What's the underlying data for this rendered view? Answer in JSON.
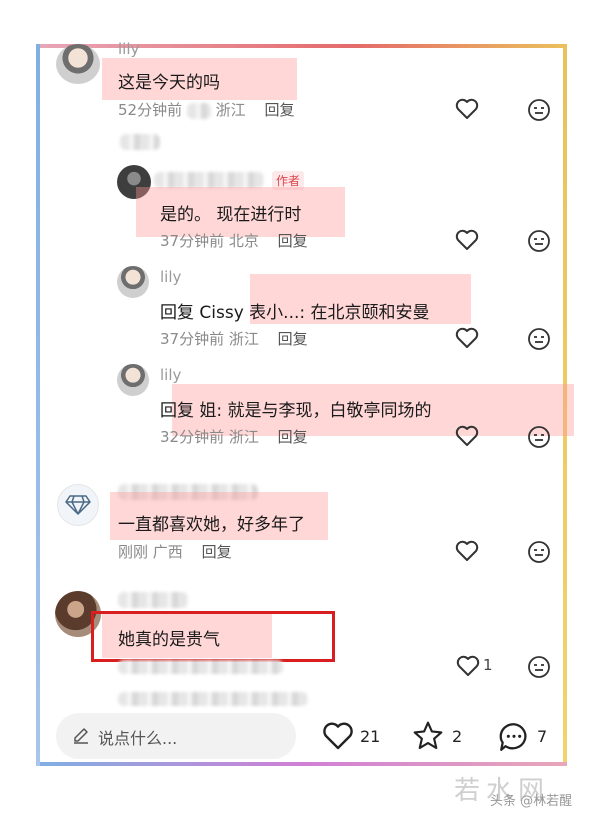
{
  "comments": [
    {
      "name": "lily",
      "text": "这是今天的吗",
      "time": "52分钟前",
      "location": "浙江",
      "reply": "回复"
    },
    {
      "author_tag": "作者",
      "text": "是的。 现在进行时",
      "time": "37分钟前",
      "location": "北京",
      "reply": "回复"
    },
    {
      "name": "lily",
      "text": "回复 Cissy 表小...: 在北京颐和安曼",
      "time": "37分钟前",
      "location": "浙江",
      "reply": "回复"
    },
    {
      "name": "lily",
      "text": "回复       姐: 就是与李现，白敬亭同场的",
      "time": "32分钟前",
      "location": "浙江",
      "reply": "回复"
    },
    {
      "text": "一直都喜欢她，好多年了",
      "time": "刚刚",
      "location": "广西",
      "reply": "回复"
    },
    {
      "text": "她真的是贵气",
      "like_count": "1"
    }
  ],
  "bottom_bar": {
    "input_placeholder": "说点什么...",
    "likes": "21",
    "favorites": "2",
    "comments": "7"
  },
  "watermark": {
    "logo": "若水网",
    "credit": "头条 @林若醒"
  },
  "colors": {
    "highlight": "#ff9696",
    "red_box": "#d81e1e",
    "author_tag": "#e0444c"
  }
}
